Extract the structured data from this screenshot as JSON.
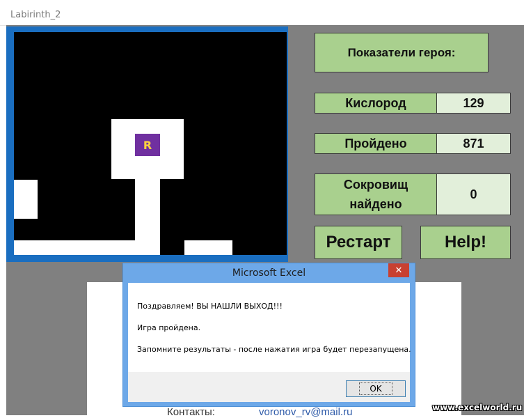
{
  "window": {
    "title": "Labirinth_2"
  },
  "maze": {
    "hero_letter": "R",
    "colors": {
      "wall": "#000000",
      "path": "#ffffff",
      "hero": "#7030a0",
      "hero_text": "#ffd23f",
      "frame": "#1a6ec0"
    }
  },
  "stats": {
    "header": "Показатели героя:",
    "oxygen_label": "Кислород",
    "oxygen_value": "129",
    "passed_label": "Пройдено",
    "passed_value": "871",
    "treasure_label_line1": "Сокровищ",
    "treasure_label_line2": "найдено",
    "treasure_value": "0"
  },
  "buttons": {
    "restart": "Рестарт",
    "help": "Help!"
  },
  "contacts": {
    "label": "Контакты:",
    "email": "voronov_rv@mail.ru"
  },
  "dialog": {
    "title": "Microsoft Excel",
    "close": "✕",
    "line1": "Поздравляем! ВЫ НАШЛИ ВЫХОД!!!",
    "line2": "Игра пройдена.",
    "line3": "Запомните результаты - после нажатия игра будет перезапущена.",
    "ok": "OK"
  },
  "watermark": "www.excelworld.ru"
}
